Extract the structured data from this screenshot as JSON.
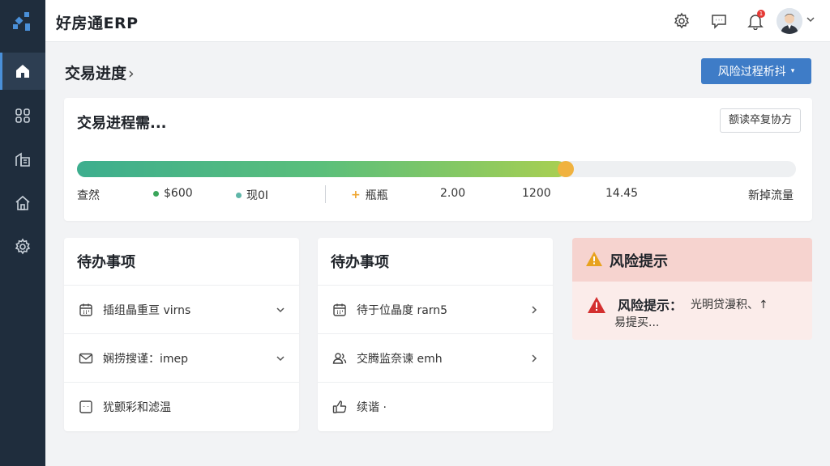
{
  "app": {
    "title": "好房通ERP"
  },
  "header": {
    "notification_count": "1"
  },
  "page": {
    "title": "交易进度",
    "chevron": "›"
  },
  "actions": {
    "risk_filter_label": "风险过程析抖",
    "risk_filter_caret": "▾"
  },
  "progress": {
    "title": "交易进程需...",
    "button_label": "额读卒复协方",
    "percent": 68,
    "legend": [
      {
        "label": "查然",
        "color": ""
      },
      {
        "label": "$600",
        "color": "#3aa55a"
      },
      {
        "label": "现0I",
        "color": "#5fb6a8"
      },
      {
        "label": "瓶瓶",
        "color": "#f0a733",
        "marker": "+"
      },
      {
        "label": "2.00",
        "color": ""
      },
      {
        "label": "1200",
        "color": ""
      },
      {
        "label": "14.45",
        "color": ""
      },
      {
        "label": "新掉流量",
        "color": ""
      }
    ]
  },
  "todo_left": {
    "title": "待办事项",
    "items": [
      {
        "label": "插组晶重亘 virns",
        "icon": "calendar-icon",
        "arrow": "chevron-down-icon"
      },
      {
        "label": "娴捞搜谨：imep",
        "icon": "mail-icon",
        "arrow": "chevron-down-icon"
      },
      {
        "label": "犹颤彩和滤温",
        "icon": "square-dots-icon",
        "arrow": ""
      }
    ]
  },
  "todo_right": {
    "title": "待办事项",
    "items": [
      {
        "label": "待于位晶度 rarn5",
        "icon": "calendar-icon",
        "arrow": "chevron-right-icon"
      },
      {
        "label": "交腾监奈谏 emh",
        "icon": "users-icon",
        "arrow": "chevron-right-icon"
      },
      {
        "label": "续谐 ·",
        "icon": "thumbs-up-icon",
        "arrow": ""
      }
    ]
  },
  "risk": {
    "head_title": "风险提示",
    "body_title": "风险提示：",
    "body_text": "光明贷漫积、↑",
    "body_text2": "易提买..."
  },
  "colors": {
    "sidebar": "#1f2d3d",
    "accent": "#3e7cc7",
    "warning": "#e8a21e",
    "danger": "#d32f2f",
    "risk_head": "#f6d3cf"
  }
}
